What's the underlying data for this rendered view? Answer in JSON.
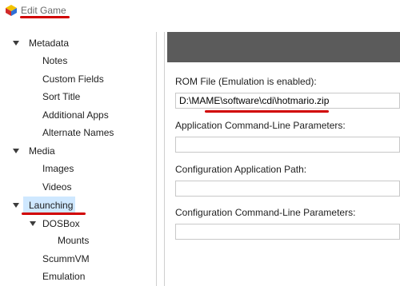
{
  "window": {
    "title": "Edit Game",
    "annotation_color": "#d10000"
  },
  "tree": {
    "items": [
      {
        "label": "Metadata",
        "level": 0,
        "expanded": true
      },
      {
        "label": "Notes",
        "level": 1
      },
      {
        "label": "Custom Fields",
        "level": 1
      },
      {
        "label": "Sort Title",
        "level": 1
      },
      {
        "label": "Additional Apps",
        "level": 1
      },
      {
        "label": "Alternate Names",
        "level": 1
      },
      {
        "label": "Media",
        "level": 0,
        "expanded": true
      },
      {
        "label": "Images",
        "level": 1
      },
      {
        "label": "Videos",
        "level": 1
      },
      {
        "label": "Launching",
        "level": 0,
        "expanded": true,
        "selected": true
      },
      {
        "label": "DOSBox",
        "level": 1,
        "expanded": true
      },
      {
        "label": "Mounts",
        "level": 2
      },
      {
        "label": "ScummVM",
        "level": 1
      },
      {
        "label": "Emulation",
        "level": 1
      }
    ]
  },
  "form": {
    "rom_label": "ROM File (Emulation is enabled):",
    "rom_value": "D:\\MAME\\software\\cdi\\hotmario.zip",
    "app_params_label": "Application Command-Line Parameters:",
    "app_params_value": "",
    "config_path_label": "Configuration Application Path:",
    "config_path_value": "",
    "config_params_label": "Configuration Command-Line Parameters:",
    "config_params_value": ""
  }
}
